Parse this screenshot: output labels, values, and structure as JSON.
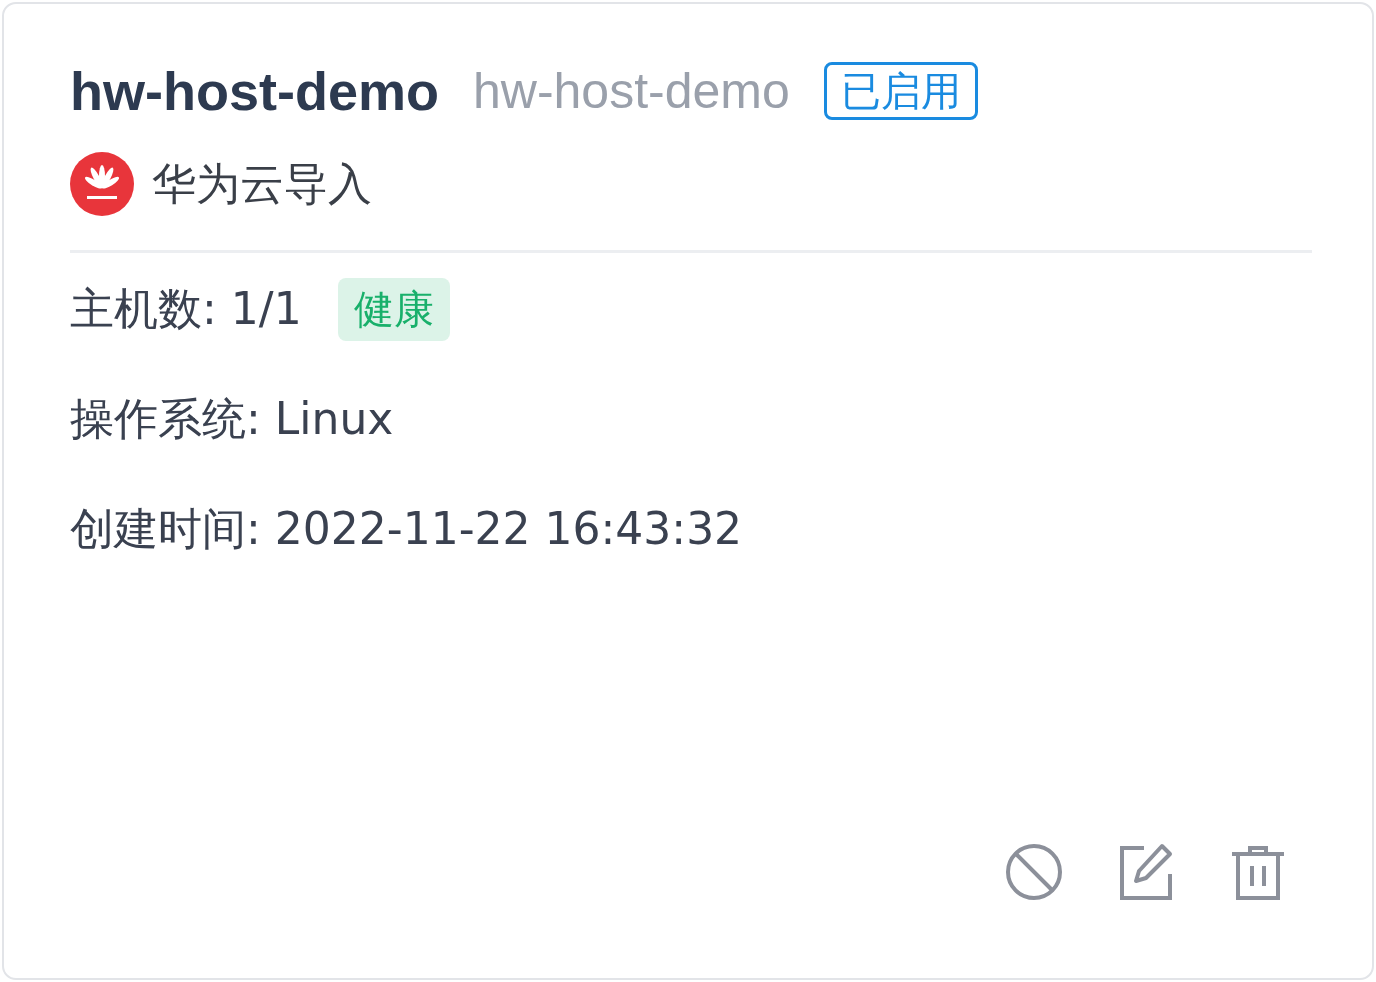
{
  "card": {
    "title": "hw-host-demo",
    "subtitle": "hw-host-demo",
    "status": {
      "label": "已启用",
      "enabled": true
    },
    "source": {
      "label": "华为云导入"
    },
    "hosts": {
      "text": "主机数: 1/1",
      "health": {
        "label": "健康",
        "kind": "healthy"
      }
    },
    "os": "操作系统: Linux",
    "created": "创建时间: 2022-11-22 16:43:32",
    "actions": [
      {
        "kind": "disable"
      },
      {
        "kind": "edit"
      },
      {
        "kind": "delete"
      }
    ]
  }
}
